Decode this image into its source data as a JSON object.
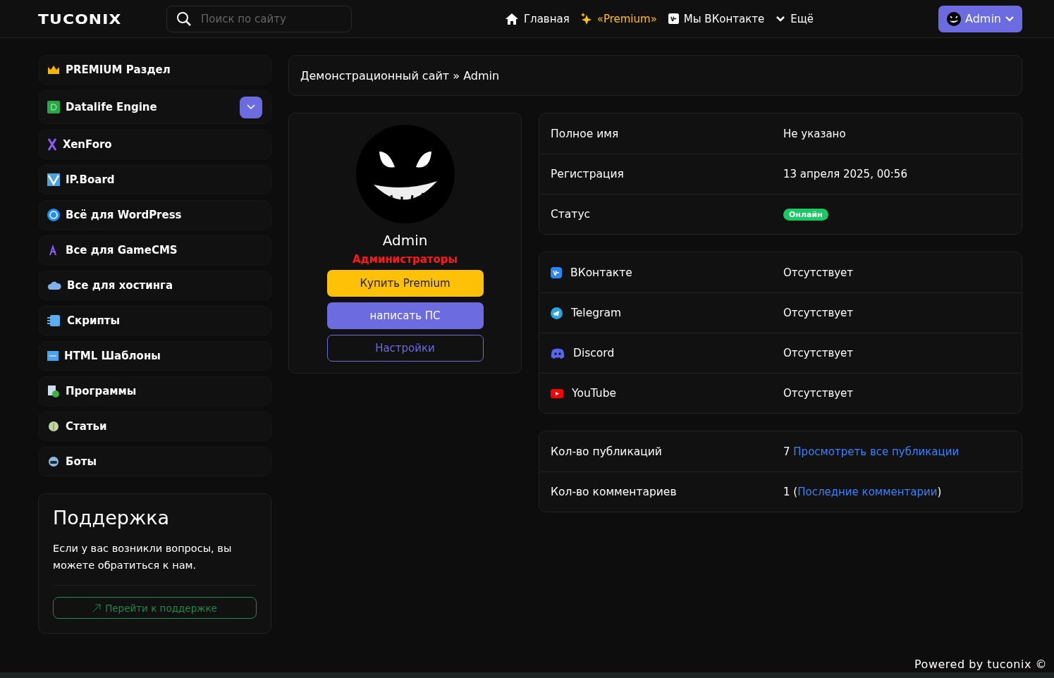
{
  "header": {
    "logo": "TUCONIX",
    "search": {
      "placeholder": "Поиск по сайту"
    },
    "nav": [
      {
        "kind": "home",
        "label": "Главная"
      },
      {
        "kind": "premium",
        "label": "«Premium»"
      },
      {
        "kind": "vk",
        "label": "Мы ВКонтакте"
      },
      {
        "kind": "more",
        "label": "Ещё"
      }
    ],
    "user_button": {
      "label": "Admin"
    }
  },
  "sidebar": {
    "items": [
      {
        "label": "PREMIUM Раздел",
        "kind": "link"
      },
      {
        "label": "Datalife Engine",
        "kind": "collapsible",
        "expanded": false
      },
      {
        "label": "XenForo",
        "kind": "link"
      },
      {
        "label": "IP.Board",
        "kind": "link"
      },
      {
        "label": "Всё для WordPress",
        "kind": "link"
      },
      {
        "label": "Все для GameCMS",
        "kind": "link"
      },
      {
        "label": "Все для хостинга",
        "kind": "link"
      },
      {
        "label": "Скрипты",
        "kind": "link"
      },
      {
        "label": "HTML Шаблоны",
        "kind": "link"
      },
      {
        "label": "Программы",
        "kind": "link"
      },
      {
        "label": "Статьи",
        "kind": "link"
      },
      {
        "label": "Боты",
        "kind": "link"
      }
    ],
    "support": {
      "title": "Поддержка",
      "text": "Если у вас возникли вопросы, вы можете обратиться к нам.",
      "button": "Перейти к поддержке"
    }
  },
  "breadcrumb": "Демонстрационный сайт » Admin",
  "profile": {
    "name": "Admin",
    "group": "Администраторы",
    "buttons": [
      {
        "kind": "premium",
        "label": "Купить Premium"
      },
      {
        "kind": "primary",
        "label": "написать ПС"
      },
      {
        "kind": "outline",
        "label": "Настройки"
      }
    ]
  },
  "info": [
    {
      "label": "Полное имя",
      "kind": "text",
      "value": "Не указано"
    },
    {
      "label": "Регистрация",
      "kind": "text",
      "value": "13 апреля 2025, 00:56"
    },
    {
      "label": "Статус",
      "kind": "badge",
      "value": "Онлайн"
    }
  ],
  "socials": [
    {
      "label": "ВКонтакте",
      "value": "Отсутствует",
      "color": "#2787f5"
    },
    {
      "label": "Telegram",
      "value": "Отсутствует",
      "color": "#2aa3df"
    },
    {
      "label": "Discord",
      "value": "Отсутствует",
      "color": "#5865f2"
    },
    {
      "label": "YouTube",
      "value": "Отсутствует",
      "color": "#ff0000"
    }
  ],
  "stats": [
    {
      "label": "Кол-во публикаций",
      "prefix": "7",
      "link": "Просмотреть все публикации"
    },
    {
      "label": "Кол-во комментариев",
      "prefix": "1 (",
      "link": "Последние комментарии",
      "suffix": ")"
    }
  ],
  "footer": "Powered by tuconix ©"
}
